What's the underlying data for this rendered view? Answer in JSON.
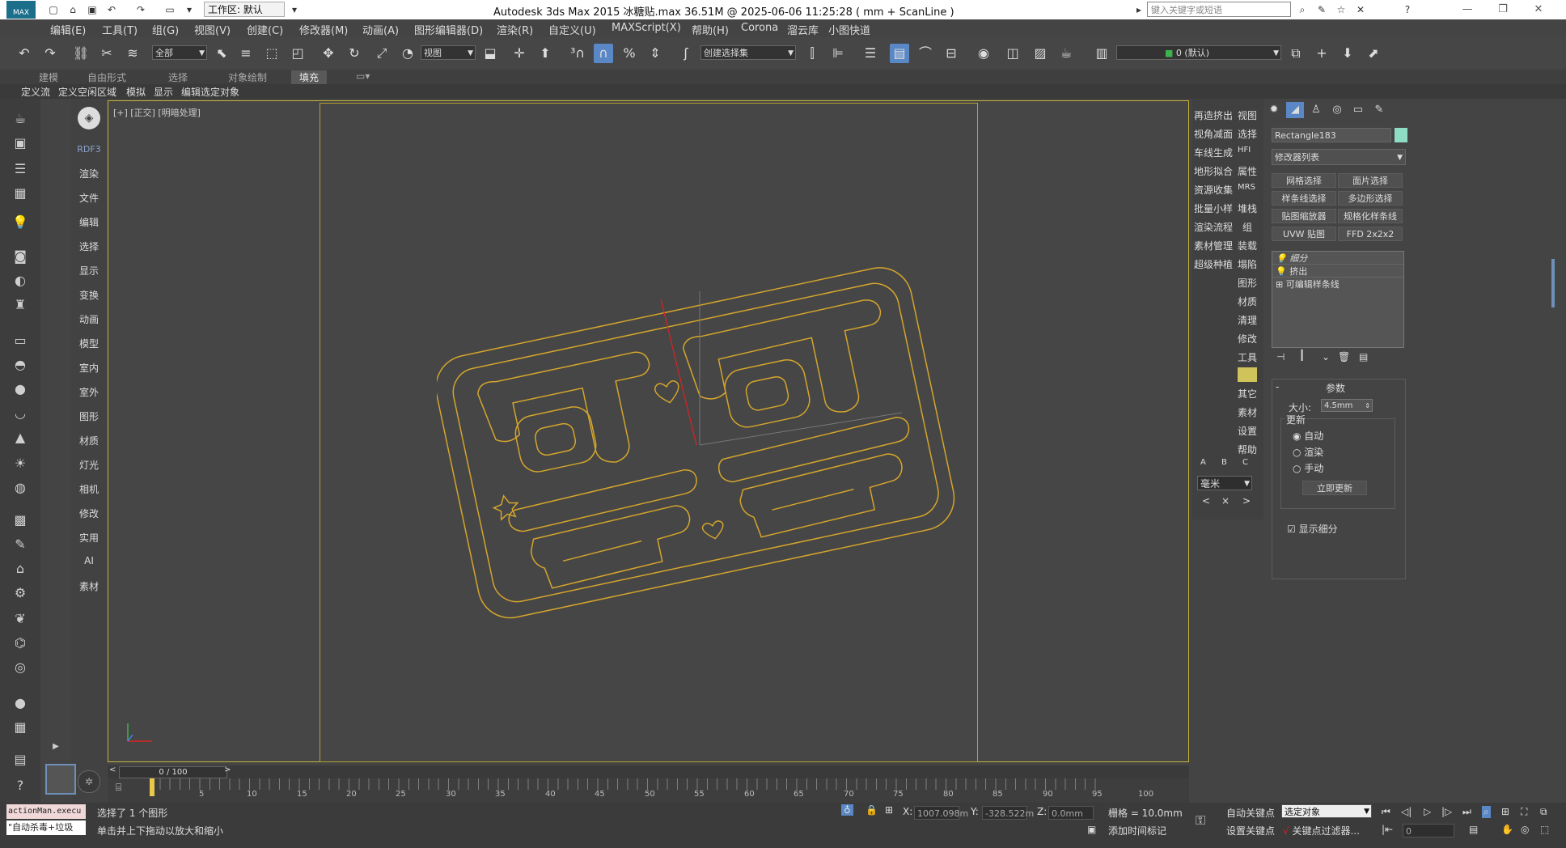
{
  "titlebar": {
    "workspace_label": "工作区: 默认",
    "title": "Autodesk 3ds Max  2015     冰糖贴.max  36.51M @ 2025-06-06 11:25:28  ( mm + ScanLine )",
    "search_placeholder": "键入关键字或短语"
  },
  "menu": [
    "编辑(E)",
    "工具(T)",
    "组(G)",
    "视图(V)",
    "创建(C)",
    "修改器(M)",
    "动画(A)",
    "图形编辑器(D)",
    "渲染(R)",
    "自定义(U)",
    "MAXScript(X)",
    "帮助(H)",
    "Corona",
    "溜云库",
    "小图快道"
  ],
  "toolbar": {
    "filter_select": "全部",
    "ref_coord": "视图",
    "selection_set": "创建选择集",
    "layer": "0 (默认)"
  },
  "ribbon_tabs": [
    "建模",
    "自由形式",
    "选择",
    "对象绘制",
    "填充"
  ],
  "subribbon": [
    "定义流",
    "定义空闲区域",
    "模拟",
    "显示",
    "编辑选定对象"
  ],
  "plugin": {
    "header": "RDF3",
    "items": [
      "渲染",
      "文件",
      "编辑",
      "选择",
      "显示",
      "变换",
      "动画",
      "模型",
      "室内",
      "室外",
      "图形",
      "材质",
      "灯光",
      "相机",
      "修改",
      "实用",
      "AI",
      "素材"
    ]
  },
  "viewport": {
    "label": "[+] [正交] [明暗处理]",
    "stamp_text": [
      "可可",
      "吾吾"
    ]
  },
  "right_plugin": {
    "col1": [
      "再造挤出",
      "视角减面",
      "车线生成",
      "地形拟合",
      "资源收集",
      "批量小样",
      "渲染流程",
      "素材管理",
      "超级种植"
    ],
    "col2": [
      "视图",
      "选择",
      "HFI",
      "属性",
      "MRS",
      "堆栈",
      "组",
      "装载",
      "塌陷",
      "图形",
      "材质",
      "清理",
      "修改",
      "工具",
      "",
      "其它",
      "素材",
      "设置",
      "帮助"
    ],
    "abc": [
      "A",
      "B",
      "C"
    ],
    "unit": "毫米"
  },
  "command_panel": {
    "object_name": "Rectangle183",
    "modifier_list": "修改器列表",
    "buttons": [
      "网格选择",
      "面片选择",
      "样条线选择",
      "多边形选择",
      "贴图缩放器",
      "规格化样条线",
      "UVW 贴图",
      "FFD 2x2x2"
    ],
    "stack": [
      "细分",
      "挤出",
      "可编辑样条线"
    ],
    "rollout_title": "参数",
    "size_label": "大小:",
    "size_value": "4.5mm",
    "update_label": "更新",
    "radios": [
      "自动",
      "渲染",
      "手动"
    ],
    "update_now": "立即更新",
    "show_subdiv": "显示细分"
  },
  "timeline": {
    "frame": "0 / 100",
    "ticks": [
      "5",
      "10",
      "15",
      "20",
      "25",
      "30",
      "35",
      "40",
      "45",
      "50",
      "55",
      "60",
      "65",
      "70",
      "75",
      "80",
      "85",
      "90",
      "95",
      "100"
    ]
  },
  "status": {
    "maxscript": "actionMan.execu",
    "maxscript2": "\"自动杀毒+垃圾",
    "selected": "选择了 1 个图形",
    "hint": "单击并上下拖动以放大和缩小",
    "x_label": "X:",
    "x": "1007.098m",
    "y_label": "Y:",
    "y": "-328.522m",
    "z_label": "Z:",
    "z": "0.0mm",
    "grid": "栅格 = 10.0mm",
    "add_time_tag": "添加时间标记",
    "auto_key": "自动关键点",
    "set_key": "设置关键点",
    "selected_obj": "选定对象",
    "key_filters": "关键点过滤器...",
    "frame_field": "0"
  },
  "colors": {
    "accent": "#5a87c5",
    "spline": "#d4a52c",
    "viewport_border": "#c9b33a"
  }
}
